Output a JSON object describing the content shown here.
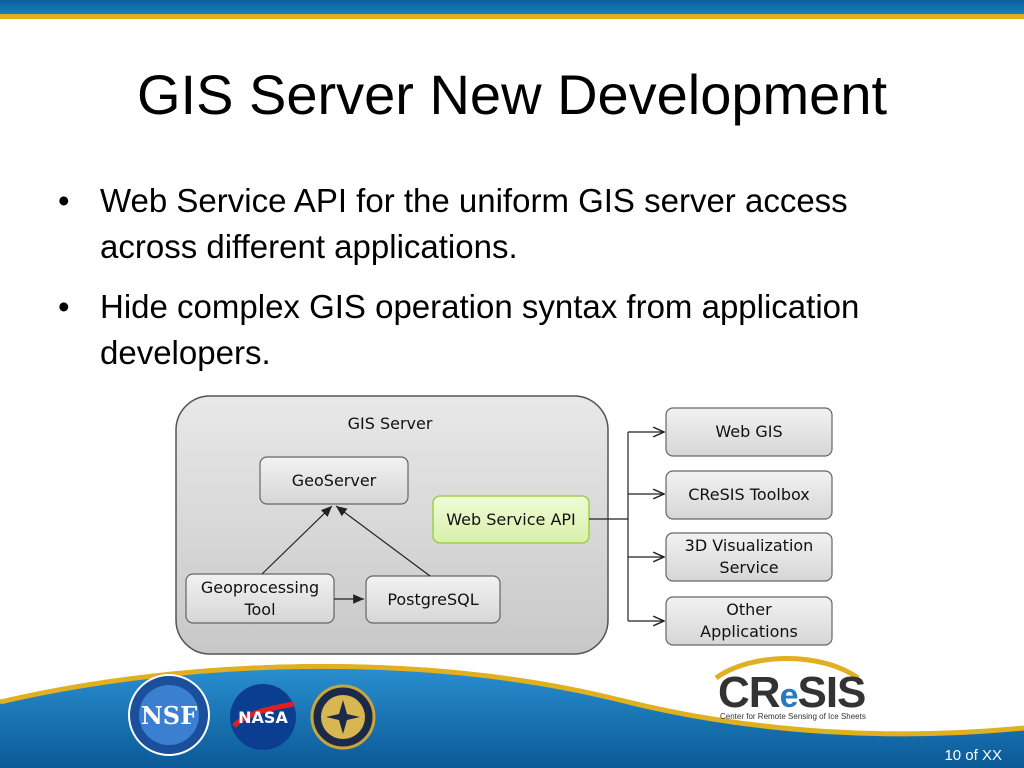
{
  "slide": {
    "title": "GIS Server New Development",
    "bullets": [
      "Web Service API for the uniform GIS server access across different applications.",
      "Hide complex GIS operation syntax from application developers."
    ],
    "page_number": "10 of XX"
  },
  "diagram": {
    "container_label": "GIS Server",
    "geoserver": "GeoServer",
    "geoprocessing_line1": "Geoprocessing",
    "geoprocessing_line2": "Tool",
    "postgresql": "PostgreSQL",
    "web_service_api": "Web Service API",
    "outputs": {
      "web_gis": "Web GIS",
      "cresis_toolbox": "CReSIS Toolbox",
      "viz_line1": "3D Visualization",
      "viz_line2": "Service",
      "other_line1": "Other",
      "other_line2": "Applications"
    },
    "colors": {
      "api_fill": "#e6f7c4",
      "api_border": "#9bd14a",
      "box_fill": "#e6e6e6"
    }
  },
  "footer": {
    "logos": [
      "nsf-logo",
      "nasa-logo",
      "kansas-board-of-regents-seal"
    ],
    "cresis_logo_cr": "CR",
    "cresis_logo_e": "e",
    "cresis_logo_sis": "SIS",
    "cresis_tagline": "Center for Remote Sensing of Ice Sheets",
    "nsf_text": "NSF",
    "nasa_text": "NASA"
  }
}
